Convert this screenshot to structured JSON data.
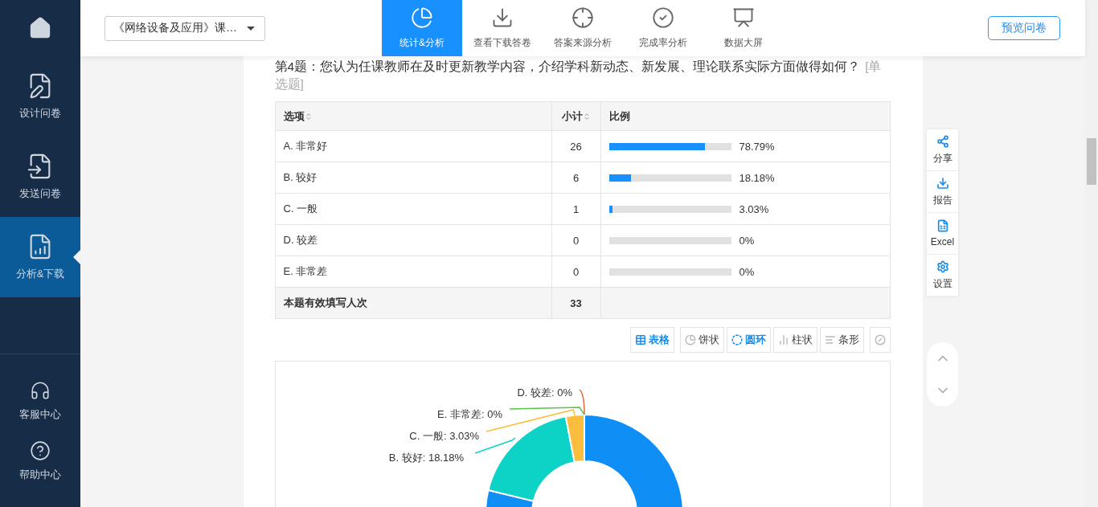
{
  "sidebar": {
    "items": [
      {
        "kind": "home",
        "selected": false
      },
      {
        "kind": "design",
        "label": "设计问卷",
        "selected": false
      },
      {
        "kind": "send",
        "label": "发送问卷",
        "selected": false
      },
      {
        "kind": "analysis",
        "label": "分析&下载",
        "selected": true
      }
    ],
    "bottom_items": [
      {
        "kind": "service",
        "label": "客服中心"
      },
      {
        "kind": "help",
        "label": "帮助中心"
      }
    ]
  },
  "header": {
    "survey_select": "《网络设备及应用》课…",
    "tabs": [
      {
        "kind": "stats",
        "label": "统计&分析",
        "selected": true
      },
      {
        "kind": "download",
        "label": "查看下载答卷",
        "selected": false
      },
      {
        "kind": "source",
        "label": "答案来源分析",
        "selected": false
      },
      {
        "kind": "completion",
        "label": "完成率分析",
        "selected": false
      },
      {
        "kind": "screen",
        "label": "数据大屏",
        "selected": false
      }
    ],
    "preview_button": "预览问卷"
  },
  "question": {
    "title": "第4题：您认为任课教师在及时更新教学内容，介绍学科新动态、新发展、理论联系实际方面做得如何？",
    "type_tag": "[单选题]"
  },
  "table": {
    "columns": [
      {
        "label": "选项",
        "sortable": true
      },
      {
        "label": "小计",
        "sortable": true
      },
      {
        "label": "比例",
        "sortable": false
      }
    ],
    "rows": [
      {
        "option": "A. 非常好",
        "count": "26",
        "level": 0.7879,
        "percent": "78.79%"
      },
      {
        "option": "B. 较好",
        "count": "6",
        "level": 0.1818,
        "percent": "18.18%"
      },
      {
        "option": "C. 一般",
        "count": "1",
        "level": 0.0303,
        "percent": "3.03%"
      },
      {
        "option": "D. 较差",
        "count": "0",
        "level": 0,
        "percent": "0%"
      },
      {
        "option": "E. 非常差",
        "count": "0",
        "level": 0,
        "percent": "0%"
      }
    ],
    "total": {
      "label": "本题有效填写人次",
      "count": "33"
    }
  },
  "chart_types": [
    {
      "kind": "table",
      "label": "表格",
      "selected": true
    },
    {
      "kind": "pie",
      "label": "饼状",
      "selected": false
    },
    {
      "kind": "donut",
      "label": "圆环",
      "selected": true
    },
    {
      "kind": "column",
      "label": "柱状",
      "selected": false
    },
    {
      "kind": "bar",
      "label": "条形",
      "selected": false
    },
    {
      "kind": "hide",
      "selected": false
    }
  ],
  "chart": {
    "slices": [
      {
        "color": "#0f8ff5"
      },
      {
        "color": "#0cd3c5"
      },
      {
        "color": "#fbbd3c"
      },
      {
        "color": "#e0683a"
      },
      {
        "color": "#59c24a"
      }
    ],
    "labels": [
      {
        "text": "D. 较差: 0%"
      },
      {
        "text": "E. 非常差: 0%"
      },
      {
        "text": "C. 一般: 3.03%"
      },
      {
        "text": "B. 较好: 18.18%"
      }
    ]
  },
  "side_tools": [
    {
      "kind": "share",
      "label": "分享"
    },
    {
      "kind": "report",
      "label": "报告"
    },
    {
      "kind": "excel",
      "label": "Excel"
    },
    {
      "kind": "settings",
      "label": "设置"
    }
  ]
}
